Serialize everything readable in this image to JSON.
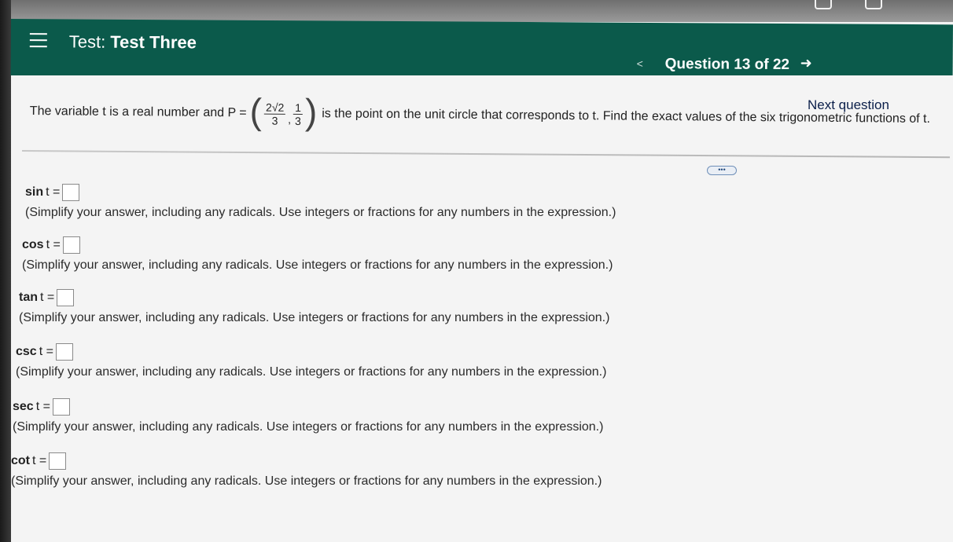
{
  "header": {
    "title_prefix": "Test:",
    "title_name": "Test Three",
    "prev_arrow": "<",
    "question_counter": "Question 13 of 22",
    "next_arrow": "➜"
  },
  "problem": {
    "text_before": "The variable t is a real number and P =",
    "x_num": "2√2",
    "x_den": "3",
    "y_num": "1",
    "y_den": "3",
    "text_after": "is the point on the unit circle that corresponds to t. Find the exact values of the six trigonometric functions of t."
  },
  "next_question": "Next question",
  "expand_button": "•••",
  "answers": [
    {
      "func": "sin",
      "label": "t =",
      "hint": "(Simplify your answer, including any radicals. Use integers or fractions for any numbers in the expression.)"
    },
    {
      "func": "cos",
      "label": "t =",
      "hint": "(Simplify your answer, including any radicals. Use integers or fractions for any numbers in the expression.)"
    },
    {
      "func": "tan",
      "label": "t =",
      "hint": "(Simplify your answer, including any radicals. Use integers or fractions for any numbers in the expression.)"
    },
    {
      "func": "csc",
      "label": "t =",
      "hint": "(Simplify your answer, including any radicals. Use integers or fractions for any numbers in the expression.)"
    },
    {
      "func": "sec",
      "label": "t =",
      "hint": "(Simplify your answer, including any radicals. Use integers or fractions for any numbers in the expression.)"
    },
    {
      "func": "cot",
      "label": "t =",
      "hint": "(Simplify your answer, including any radicals. Use integers or fractions for any numbers in the expression.)"
    }
  ]
}
